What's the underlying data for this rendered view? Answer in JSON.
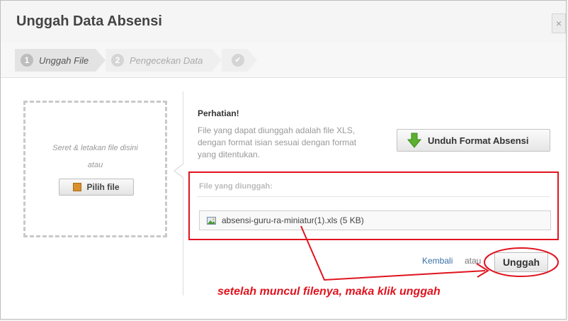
{
  "dialog": {
    "title": "Unggah Data Absensi",
    "close_icon": "close-icon"
  },
  "steps": [
    {
      "number": "1",
      "label": "Unggah File",
      "state": "active"
    },
    {
      "number": "2",
      "label": "Pengecekan Data",
      "state": "pending"
    },
    {
      "icon": "check-icon",
      "state": "pending"
    }
  ],
  "dropzone": {
    "line1": "Seret & letakan file disini",
    "line2": "atau",
    "pick_button": "Pilih file",
    "pick_icon": "box-icon"
  },
  "notice": {
    "title": "Perhatian!",
    "text": "File yang dapat diunggah adalah file XLS, dengan format isian sesuai dengan format yang ditentukan."
  },
  "download_button": {
    "label": "Unduh Format Absensi",
    "icon": "download-arrow-icon"
  },
  "uploaded": {
    "label": "File yang diunggah:",
    "files": [
      {
        "name": "absensi-guru-ra-miniatur(1).xls (5 KB)",
        "icon": "image-file-icon"
      }
    ]
  },
  "footer": {
    "back_link": "Kembali",
    "or_text": "atau",
    "upload_button": "Unggah"
  },
  "annotation": {
    "text": "setelah muncul filenya, maka klik unggah",
    "color": "#e0141f"
  },
  "colors": {
    "accent_red": "#e0141f",
    "link_blue": "#3b6fa8",
    "download_green": "#5cb030"
  }
}
